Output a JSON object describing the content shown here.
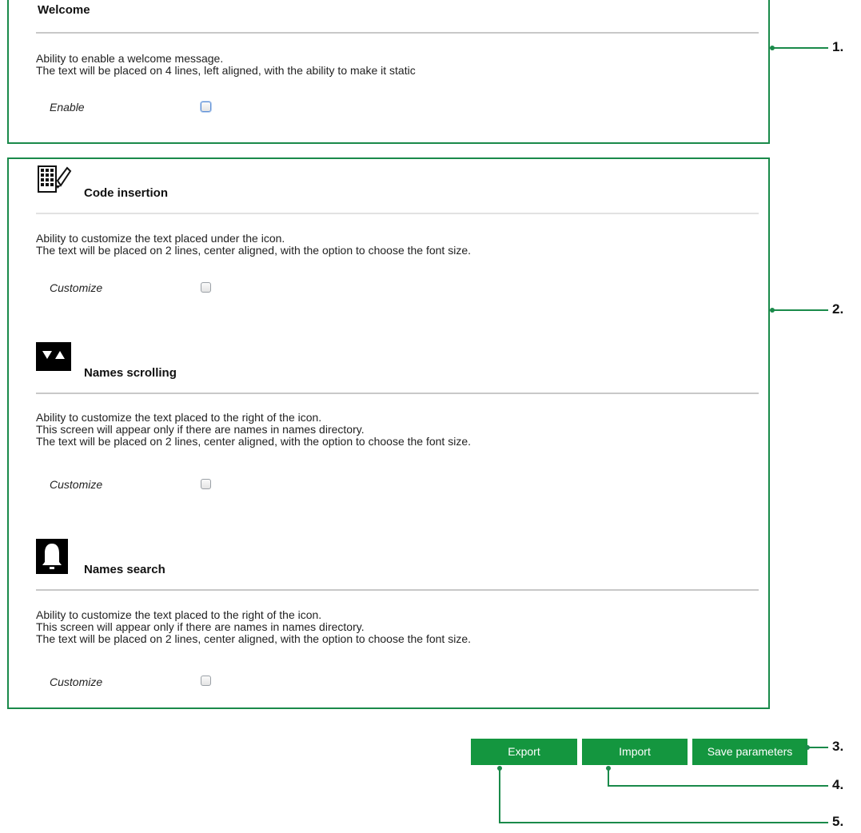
{
  "welcome": {
    "title": "Welcome",
    "description": "Ability to enable a welcome message.\nThe text will be placed on 4 lines, left aligned, with the ability to make it static",
    "option_label": "Enable"
  },
  "sections": [
    {
      "title": "Code insertion",
      "icon": "keypad-icon",
      "description": "Ability to customize the text placed under the icon.\nThe text will be placed on 2 lines, center aligned, with the option to choose the font size.",
      "option_label": "Customize"
    },
    {
      "title": "Names scrolling",
      "icon": "scroll-arrows-icon",
      "description": "Ability to customize the text placed to the right of the icon.\nThis screen will appear only if there are names in names directory.\nThe text will be placed on 2 lines, center aligned, with the option to choose the font size.",
      "option_label": "Customize"
    },
    {
      "title": "Names search",
      "icon": "bell-icon",
      "description": "Ability to customize the text placed to the right of the icon.\nThis screen will appear only if there are names in names directory.\nThe text will be placed on 2 lines, center aligned, with the option to choose the font size.",
      "option_label": "Customize"
    }
  ],
  "buttons": {
    "export": "Export",
    "import": "Import",
    "save": "Save parameters"
  },
  "callouts": [
    "1.",
    "2.",
    "3.",
    "4.",
    "5."
  ],
  "colors": {
    "accent": "#1a8a4a",
    "button": "#14963f"
  }
}
